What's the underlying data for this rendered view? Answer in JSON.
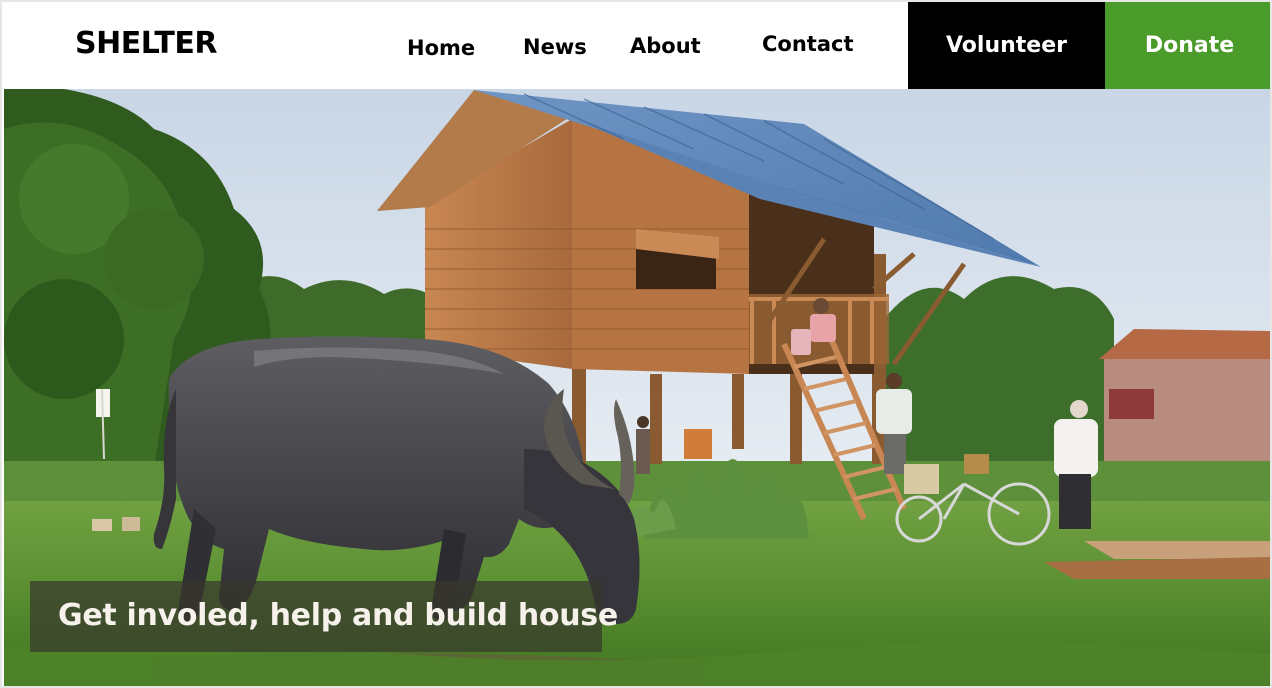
{
  "header": {
    "logo": "SHELTER",
    "nav": {
      "home": "Home",
      "news": "News",
      "about": "About",
      "contact": "Contact"
    },
    "volunteer_label": "Volunteer",
    "donate_label": "Donate"
  },
  "hero": {
    "caption": "Get involed, help and build house"
  },
  "colors": {
    "donate_bg": "#4a9b2a",
    "volunteer_bg": "#000000",
    "caption_bg": "rgba(55,55,45,0.72)"
  }
}
